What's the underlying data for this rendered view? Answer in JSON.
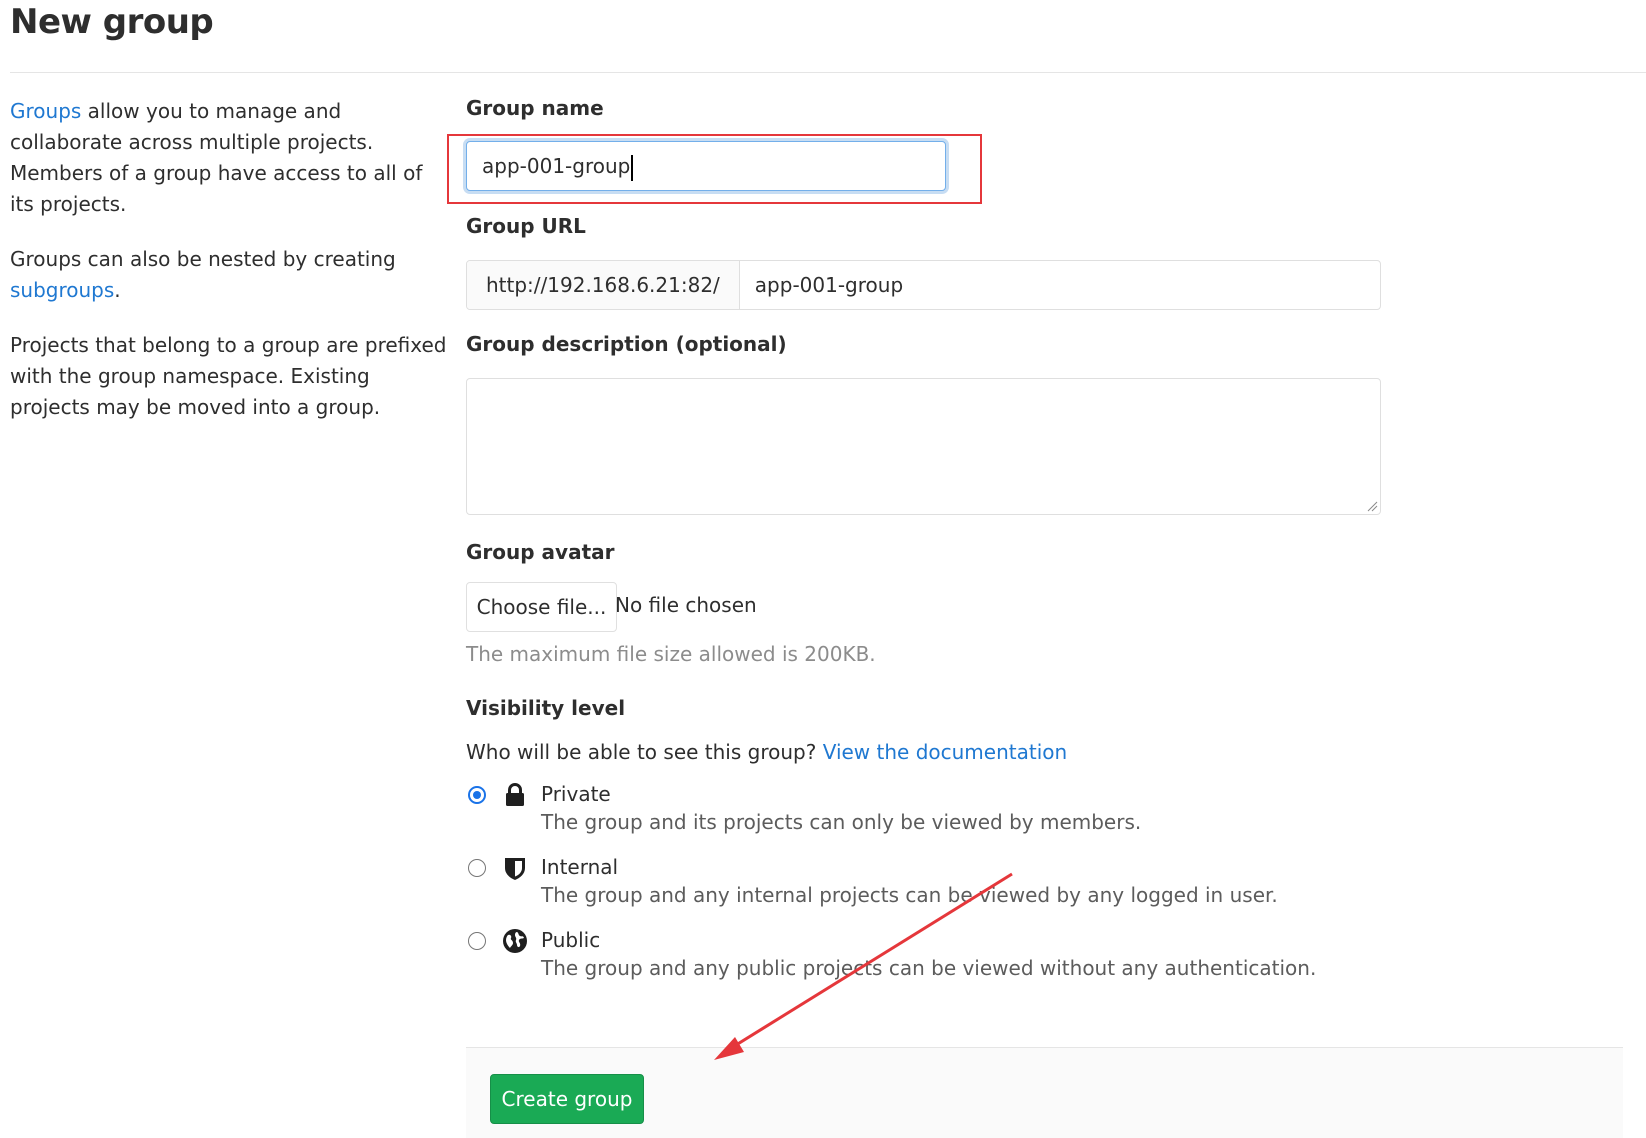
{
  "page": {
    "title": "New group"
  },
  "sidebar": {
    "p1_link": "Groups",
    "p1_rest": " allow you to manage and collaborate across multiple projects. Members of a group have access to all of its projects.",
    "p2_text": "Groups can also be nested by creating ",
    "p2_link": "subgroups",
    "p2_end": ".",
    "p3_text": "Projects that belong to a group are prefixed with the group namespace. Existing projects may be moved into a group."
  },
  "form": {
    "group_name": {
      "label": "Group name",
      "value": "app-001-group"
    },
    "group_url": {
      "label": "Group URL",
      "prefix": "http://192.168.6.21:82/",
      "path": "app-001-group"
    },
    "description": {
      "label": "Group description (optional)",
      "value": ""
    },
    "avatar": {
      "label": "Group avatar",
      "button_label": "Choose file...",
      "status": "No file chosen",
      "hint": "The maximum file size allowed is 200KB."
    },
    "visibility": {
      "label": "Visibility level",
      "question": "Who will be able to see this group?",
      "doc_link": "View the documentation",
      "options": [
        {
          "title": "Private",
          "description": "The group and its projects can only be viewed by members.",
          "icon": "lock-icon",
          "checked": true
        },
        {
          "title": "Internal",
          "description": "The group and any internal projects can be viewed by any logged in user.",
          "icon": "shield-icon",
          "checked": false
        },
        {
          "title": "Public",
          "description": "The group and any public projects can be viewed without any authentication.",
          "icon": "globe-icon",
          "checked": false
        }
      ]
    },
    "submit_label": "Create group"
  },
  "colors": {
    "link": "#1f78d1",
    "primary_button": "#1aaa55",
    "annotation_red": "#e5373b",
    "radio_checked": "#1a73e8"
  }
}
